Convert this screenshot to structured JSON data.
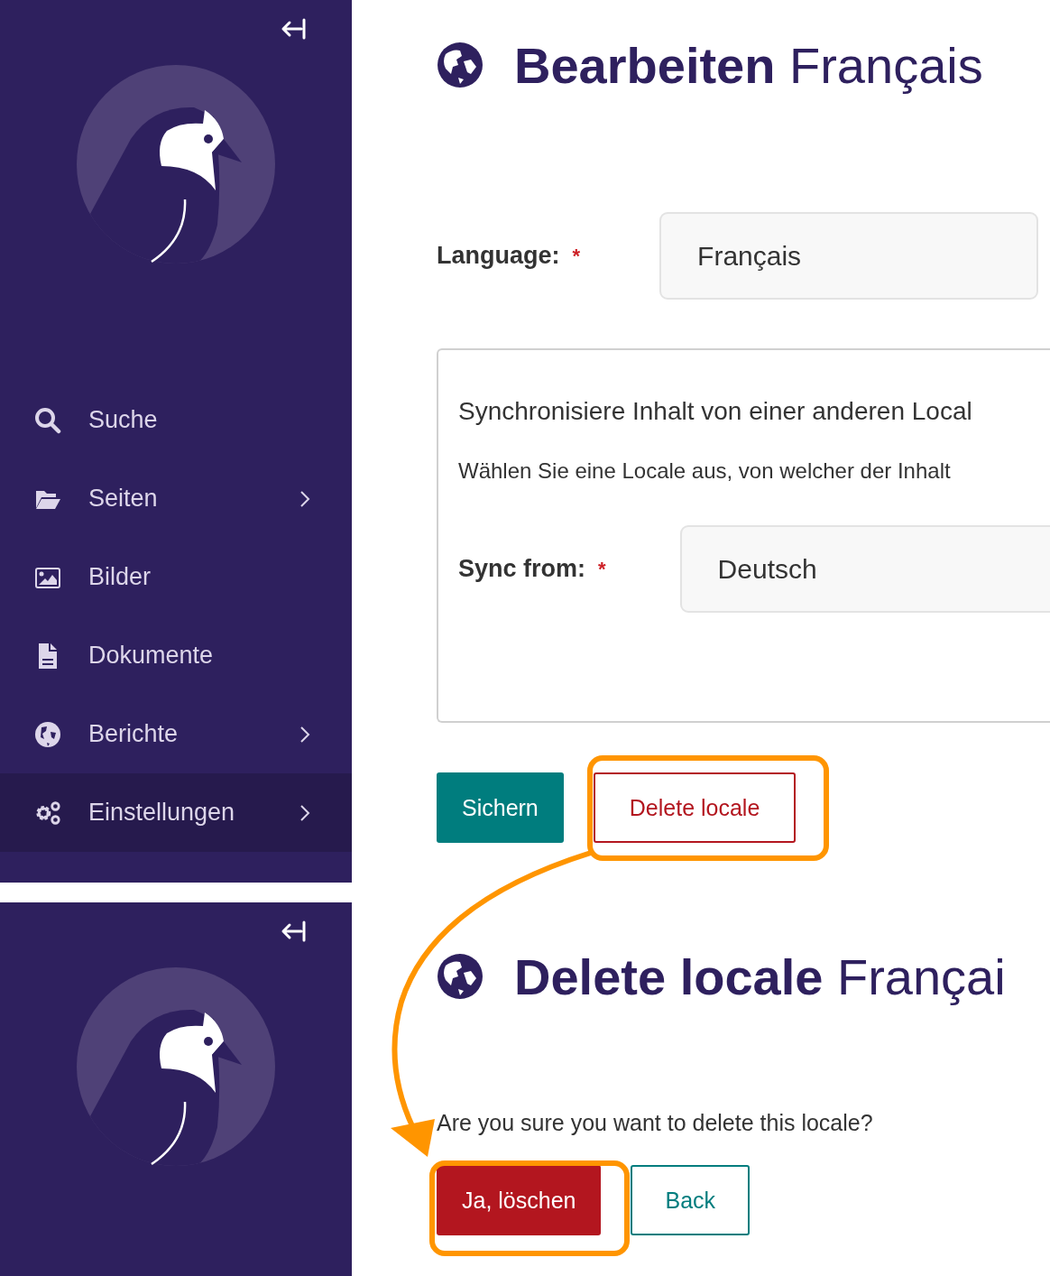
{
  "edit_screen": {
    "sidebar": {
      "items": [
        {
          "label": "Suche",
          "kind": "search",
          "expandable": false,
          "selected": false
        },
        {
          "label": "Seiten",
          "kind": "folder",
          "expandable": true,
          "selected": false
        },
        {
          "label": "Bilder",
          "kind": "image",
          "expandable": false,
          "selected": false
        },
        {
          "label": "Dokumente",
          "kind": "document",
          "expandable": false,
          "selected": false
        },
        {
          "label": "Berichte",
          "kind": "globe",
          "expandable": true,
          "selected": false
        },
        {
          "label": "Einstellungen",
          "kind": "gears",
          "expandable": true,
          "selected": true
        }
      ]
    },
    "heading": {
      "action": "Bearbeiten",
      "subject": "Français"
    },
    "language_field": {
      "label": "Language:",
      "required_mark": "*",
      "value": "Français"
    },
    "sync_panel": {
      "title": "Synchronisiere Inhalt von einer anderen Local",
      "help": "Wählen Sie eine Locale aus, von welcher der Inhalt",
      "field": {
        "label": "Sync from:",
        "required_mark": "*",
        "value": "Deutsch"
      }
    },
    "buttons": [
      {
        "label": "Sichern",
        "kind": "primary"
      },
      {
        "label": "Delete locale",
        "kind": "danger-outline"
      }
    ]
  },
  "delete_screen": {
    "heading": {
      "action": "Delete locale",
      "subject": "Françai"
    },
    "question": "Are you sure you want to delete this locale?",
    "buttons": [
      {
        "label": "Ja, löschen",
        "kind": "danger"
      },
      {
        "label": "Back",
        "kind": "outline"
      }
    ]
  }
}
